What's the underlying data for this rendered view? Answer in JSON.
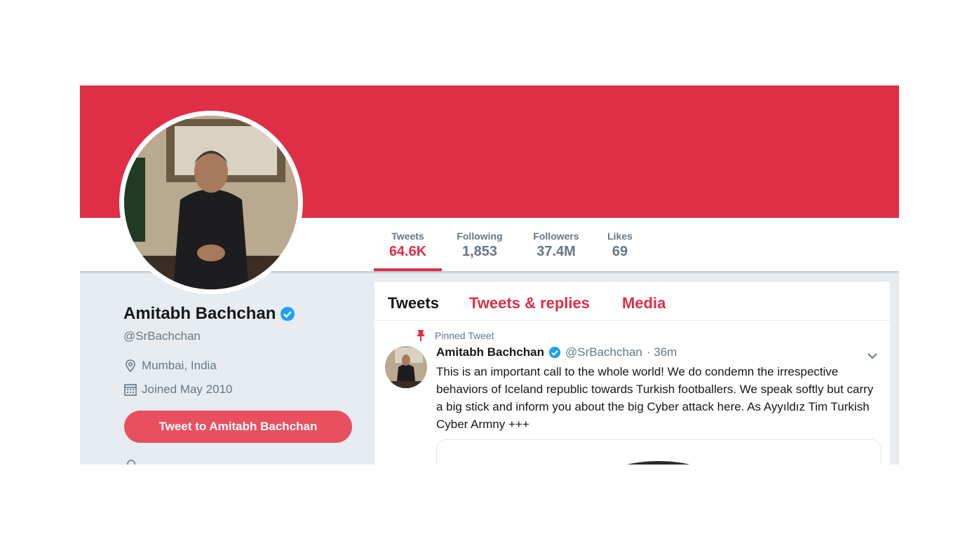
{
  "colors": {
    "accent": "#df2e46",
    "button": "#e8505f",
    "muted": "#657786",
    "verified": "#1da1f2"
  },
  "stats": [
    {
      "label": "Tweets",
      "value": "64.6K",
      "active": true
    },
    {
      "label": "Following",
      "value": "1,853",
      "active": false
    },
    {
      "label": "Followers",
      "value": "37.4M",
      "active": false
    },
    {
      "label": "Likes",
      "value": "69",
      "active": false
    }
  ],
  "profile": {
    "name": "Amitabh Bachchan",
    "handle": "@SrBachchan",
    "location": "Mumbai, India",
    "joined": "Joined May 2010",
    "tweet_to_label": "Tweet to Amitabh Bachchan",
    "verified_icon": "verified-badge-icon",
    "location_icon": "map-pin-icon",
    "calendar_icon": "calendar-icon"
  },
  "timeline": {
    "tabs": [
      {
        "label": "Tweets",
        "active": true
      },
      {
        "label": "Tweets & replies",
        "active": false
      },
      {
        "label": "Media",
        "active": false
      }
    ],
    "pinned_label": "Pinned Tweet",
    "tweet": {
      "name": "Amitabh Bachchan",
      "handle": "@SrBachchan",
      "time": "· 36m",
      "text": "This is an important call to the whole world! We do condemn the irrespective behaviors of Iceland republic towards Turkish footballers. We speak softly but carry a big stick and inform you about the big Cyber attack here. As Ayyıldız Tim Turkish Cyber Armny +++"
    }
  }
}
